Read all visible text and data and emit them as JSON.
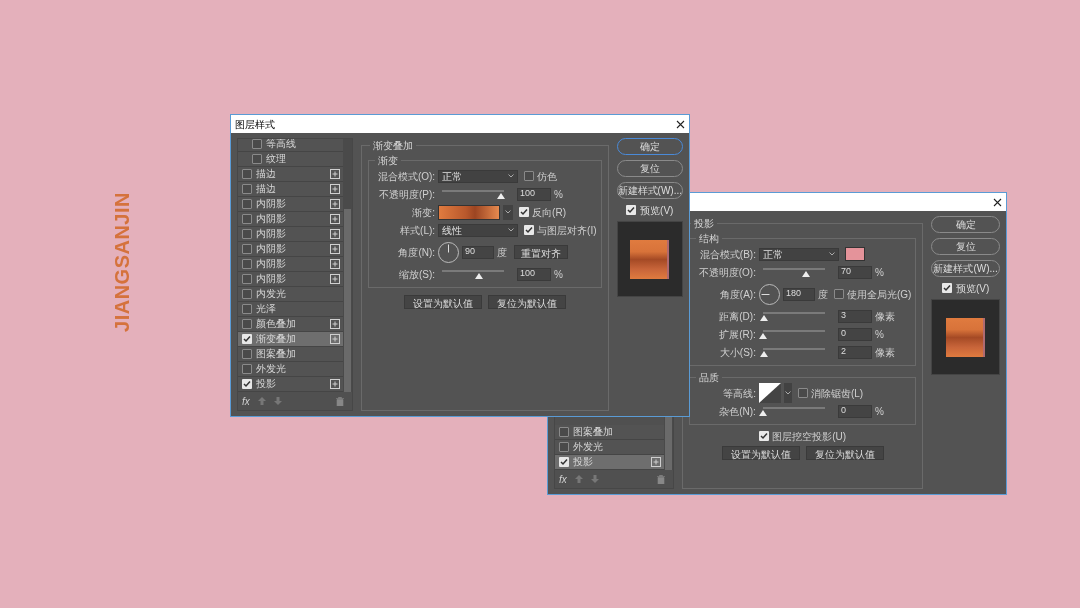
{
  "brand": {
    "text": "JIANGSANJIN"
  },
  "dialogs": [
    {
      "title": "图层样式",
      "effects": [
        {
          "label": "等高线",
          "kind": "sub",
          "checked": false,
          "selected": false,
          "has_add": false
        },
        {
          "label": "纹理",
          "kind": "sub",
          "checked": false,
          "selected": false,
          "has_add": false
        },
        {
          "label": "描边",
          "kind": "effect",
          "checked": false,
          "selected": false,
          "has_add": true
        },
        {
          "label": "描边",
          "kind": "effect",
          "checked": false,
          "selected": false,
          "has_add": true
        },
        {
          "label": "内阴影",
          "kind": "effect",
          "checked": false,
          "selected": false,
          "has_add": true
        },
        {
          "label": "内阴影",
          "kind": "effect",
          "checked": false,
          "selected": false,
          "has_add": true
        },
        {
          "label": "内阴影",
          "kind": "effect",
          "checked": false,
          "selected": false,
          "has_add": true
        },
        {
          "label": "内阴影",
          "kind": "effect",
          "checked": false,
          "selected": false,
          "has_add": true
        },
        {
          "label": "内阴影",
          "kind": "effect",
          "checked": false,
          "selected": false,
          "has_add": true
        },
        {
          "label": "内阴影",
          "kind": "effect",
          "checked": false,
          "selected": false,
          "has_add": true
        },
        {
          "label": "内发光",
          "kind": "effect",
          "checked": false,
          "selected": false,
          "has_add": false
        },
        {
          "label": "光泽",
          "kind": "effect",
          "checked": false,
          "selected": false,
          "has_add": false
        },
        {
          "label": "颜色叠加",
          "kind": "effect",
          "checked": false,
          "selected": false,
          "has_add": true
        },
        {
          "label": "渐变叠加",
          "kind": "effect",
          "checked": true,
          "selected": true,
          "has_add": true
        },
        {
          "label": "图案叠加",
          "kind": "effect",
          "checked": false,
          "selected": false,
          "has_add": false
        },
        {
          "label": "外发光",
          "kind": "effect",
          "checked": false,
          "selected": false,
          "has_add": false
        },
        {
          "label": "投影",
          "kind": "effect",
          "checked": true,
          "selected": false,
          "has_add": true
        }
      ],
      "toolbar": {
        "fx": "fx"
      },
      "panel": {
        "title": "渐变叠加",
        "groups": [
          {
            "title": "渐变",
            "rows": [
              {
                "kind": "select",
                "label": "混合模式(O):",
                "value": "正常",
                "extra": {
                  "kind": "checkbox",
                  "label": "仿色",
                  "checked": false
                }
              },
              {
                "kind": "slider",
                "label": "不透明度(P):",
                "level": 0.95,
                "value": "100",
                "unit": "%"
              },
              {
                "kind": "gradient",
                "label": "渐变:",
                "extra": {
                  "kind": "checkbox",
                  "label": "反向(R)",
                  "checked": true
                }
              },
              {
                "kind": "select",
                "label": "样式(L):",
                "value": "线性",
                "extra": {
                  "kind": "checkbox",
                  "label": "与图层对齐(I)",
                  "checked": true
                }
              },
              {
                "kind": "angle",
                "label": "角度(N):",
                "value": "90",
                "unit": "度",
                "extra": {
                  "kind": "button",
                  "label": "重置对齐"
                }
              },
              {
                "kind": "slider",
                "label": "缩放(S):",
                "level": 0.6,
                "value": "100",
                "unit": "%"
              }
            ]
          }
        ],
        "buttons": [
          "设置为默认值",
          "复位为默认值"
        ]
      },
      "actions": [
        {
          "label": "确定",
          "focused": true
        },
        {
          "label": "复位",
          "focused": false
        },
        {
          "label": "新建样式(W)...",
          "focused": false
        }
      ],
      "preview": {
        "label": "预览(V)",
        "checked": true
      }
    },
    {
      "effects": [
        {
          "label": "图案叠加",
          "kind": "effect",
          "checked": false,
          "selected": false,
          "has_add": false
        },
        {
          "label": "外发光",
          "kind": "effect",
          "checked": false,
          "selected": false,
          "has_add": false
        },
        {
          "label": "投影",
          "kind": "effect",
          "checked": true,
          "selected": true,
          "has_add": true
        }
      ],
      "toolbar": {
        "fx": "fx"
      },
      "panel": {
        "title": "投影",
        "groups": [
          {
            "title": "结构",
            "rows": [
              {
                "kind": "select",
                "label": "混合模式(B):",
                "value": "正常",
                "extra": {
                  "kind": "swatch",
                  "color": "#e4939a"
                }
              },
              {
                "kind": "slider",
                "label": "不透明度(O):",
                "level": 0.7,
                "value": "70",
                "unit": "%"
              },
              {
                "kind": "angle",
                "label": "角度(A):",
                "value": "180",
                "unit": "度",
                "extra": {
                  "kind": "checkbox",
                  "label": "使用全局光(G)",
                  "checked": false
                }
              },
              {
                "kind": "slider",
                "label": "距离(D):",
                "level": 0.02,
                "value": "3",
                "unit": "像素"
              },
              {
                "kind": "slider",
                "label": "扩展(R):",
                "level": 0,
                "value": "0",
                "unit": "%"
              },
              {
                "kind": "slider",
                "label": "大小(S):",
                "level": 0.02,
                "value": "2",
                "unit": "像素"
              }
            ]
          },
          {
            "title": "品质",
            "rows": [
              {
                "kind": "contour",
                "label": "等高线:",
                "extra": {
                  "kind": "checkbox",
                  "label": "消除锯齿(L)",
                  "checked": false
                }
              },
              {
                "kind": "slider",
                "label": "杂色(N):",
                "level": 0,
                "value": "0",
                "unit": "%"
              }
            ]
          }
        ],
        "knockout": {
          "label": "图层挖空投影(U)",
          "checked": true
        },
        "buttons": [
          "设置为默认值",
          "复位为默认值"
        ]
      },
      "actions": [
        {
          "label": "确定",
          "focused": false
        },
        {
          "label": "复位",
          "focused": false
        },
        {
          "label": "新建样式(W)...",
          "focused": false
        }
      ],
      "preview": {
        "label": "预览(V)",
        "checked": true
      }
    }
  ]
}
